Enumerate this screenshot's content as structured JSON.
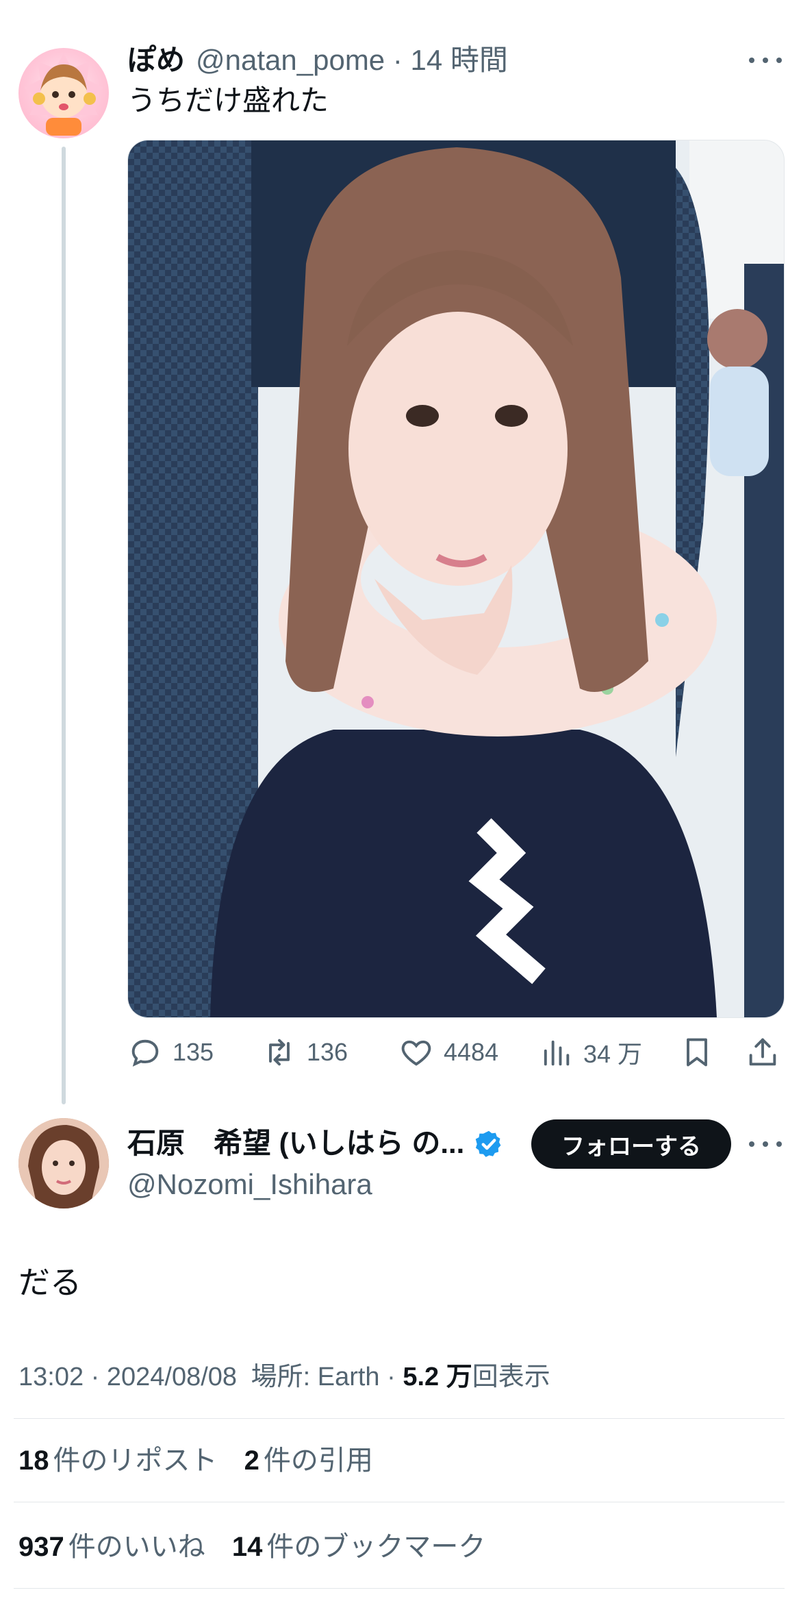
{
  "tweet": {
    "author_name": "ぽめ",
    "author_handle": "@natan_pome",
    "time": "· 14 時間",
    "text": "うちだけ盛れた",
    "actions": {
      "reply_count": "135",
      "retweet_count": "136",
      "like_count": "4484",
      "views_count": "34 万"
    }
  },
  "quote": {
    "name": "石原　希望 (いしはら の...",
    "handle": "@Nozomi_Ishihara",
    "follow_label": "フォローする",
    "text": "だる",
    "meta": {
      "time_date": "13:02 · 2024/08/08",
      "location": "場所: Earth",
      "views_number": "5.2 万",
      "views_label": "回表示"
    },
    "stats": {
      "reposts_number": "18",
      "reposts_label": "件のリポスト",
      "quotes_number": "2",
      "quotes_label": "件の引用",
      "likes_number": "937",
      "likes_label": "件のいいね",
      "bookmarks_number": "14",
      "bookmarks_label": "件のブックマーク"
    }
  },
  "icons": {
    "more": "more-horizontal-icon",
    "reply": "reply-icon",
    "retweet": "retweet-icon",
    "like": "heart-icon",
    "views": "analytics-icon",
    "bookmark": "bookmark-icon",
    "share": "share-icon",
    "verified": "verified-badge-icon"
  },
  "colors": {
    "text": "#0f1419",
    "muted": "#536471",
    "verified": "#1d9bf0",
    "follow_button": "#0f1419"
  }
}
